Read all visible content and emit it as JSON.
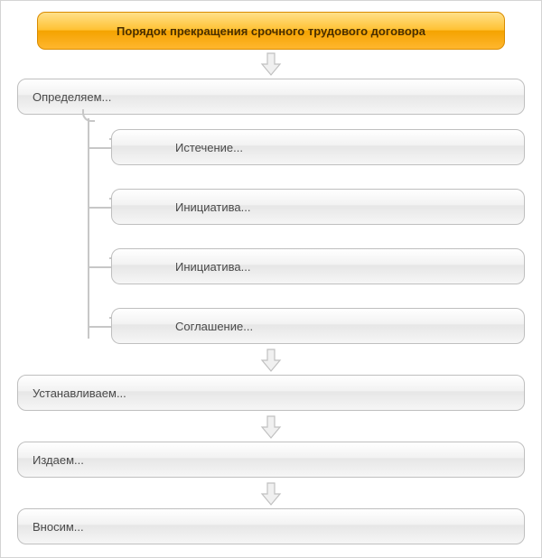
{
  "title": "Порядок прекращения срочного трудового договора",
  "steps": {
    "s1": "Определяем...",
    "s2": "Устанавливаем...",
    "s3": "Издаем...",
    "s4": "Вносим..."
  },
  "branches": {
    "b1": "Истечение...",
    "b2": "Инициатива...",
    "b3": "Инициатива...",
    "b4": "Соглашение..."
  },
  "colors": {
    "title_gradient_top": "#ffe08a",
    "title_gradient_bottom": "#f4a300",
    "node_border": "#bfbfbf",
    "connector": "#c7c7c7"
  }
}
